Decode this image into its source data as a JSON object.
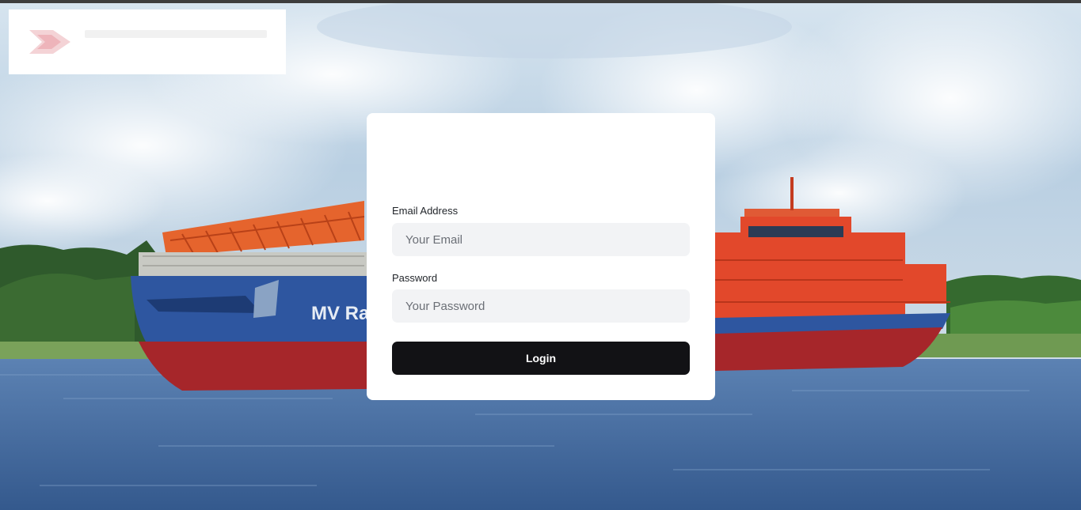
{
  "login": {
    "email_label": "Email Address",
    "email_placeholder": "Your Email",
    "password_label": "Password",
    "password_placeholder": "Your Password",
    "submit_label": "Login"
  },
  "background": {
    "ship_name_visible": "MV Ra",
    "sky_color": "#b9cfe2",
    "water_color": "#3f6a9e",
    "hull_blue": "#2e56a0",
    "hull_red": "#a6262a",
    "superstructure_orange": "#e2482b"
  },
  "logo": {
    "mark_color": "#e9a1a6"
  }
}
